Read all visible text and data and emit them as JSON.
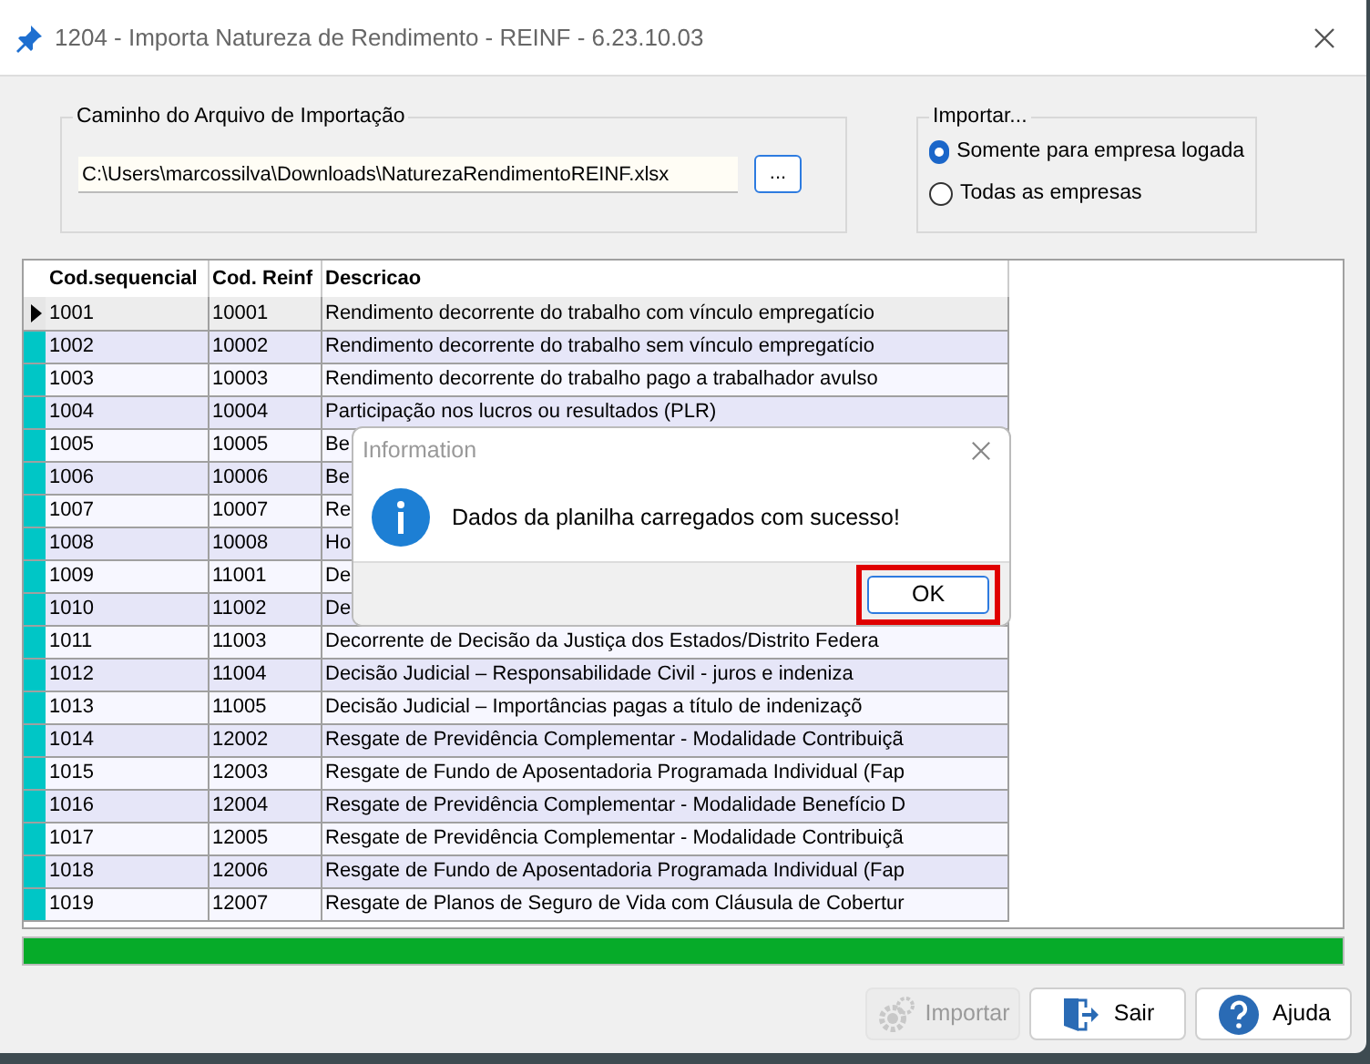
{
  "window": {
    "title": "1204 - Importa Natureza de Rendimento - REINF - 6.23.10.03"
  },
  "file_group": {
    "label": "Caminho do Arquivo de Importação",
    "path": "C:\\Users\\marcossilva\\Downloads\\NaturezaRendimentoREINF.xlsx",
    "browse_button": "..."
  },
  "import_group": {
    "label": "Importar...",
    "options": [
      {
        "label": "Somente para empresa logada",
        "selected": true
      },
      {
        "label": "Todas as empresas",
        "selected": false
      }
    ]
  },
  "table": {
    "columns": [
      "Cod.sequencial",
      "Cod. Reinf",
      "Descricao"
    ],
    "rows": [
      {
        "cells": [
          "1001",
          "10001",
          "Rendimento decorrente do trabalho com vínculo empregatício"
        ],
        "selected": true
      },
      {
        "cells": [
          "1002",
          "10002",
          "Rendimento decorrente do trabalho sem vínculo empregatício"
        ],
        "selected": false
      },
      {
        "cells": [
          "1003",
          "10003",
          "Rendimento decorrente do trabalho pago a trabalhador avulso"
        ],
        "selected": false
      },
      {
        "cells": [
          "1004",
          "10004",
          "Participação nos lucros ou resultados (PLR)"
        ],
        "selected": false
      },
      {
        "cells": [
          "1005",
          "10005",
          "Be"
        ],
        "selected": false
      },
      {
        "cells": [
          "1006",
          "10006",
          "Be"
        ],
        "selected": false
      },
      {
        "cells": [
          "1007",
          "10007",
          "Re"
        ],
        "selected": false
      },
      {
        "cells": [
          "1008",
          "10008",
          "Ho"
        ],
        "selected": false
      },
      {
        "cells": [
          "1009",
          "11001",
          "De"
        ],
        "selected": false
      },
      {
        "cells": [
          "1010",
          "11002",
          "De"
        ],
        "selected": false
      },
      {
        "cells": [
          "1011",
          "11003",
          "Decorrente de Decisão da Justiça dos Estados/Distrito Federa"
        ],
        "selected": false
      },
      {
        "cells": [
          "1012",
          "11004",
          "Decisão Judicial – Responsabilidade Civil - juros e indeniza"
        ],
        "selected": false
      },
      {
        "cells": [
          "1013",
          "11005",
          "Decisão Judicial – Importâncias pagas a título de indenizaçõ"
        ],
        "selected": false
      },
      {
        "cells": [
          "1014",
          "12002",
          "Resgate de Previdência Complementar - Modalidade Contribuiçã"
        ],
        "selected": false
      },
      {
        "cells": [
          "1015",
          "12003",
          "Resgate de Fundo de Aposentadoria Programada Individual (Fap"
        ],
        "selected": false
      },
      {
        "cells": [
          "1016",
          "12004",
          "Resgate de Previdência Complementar - Modalidade Benefício D"
        ],
        "selected": false
      },
      {
        "cells": [
          "1017",
          "12005",
          "Resgate de Previdência Complementar - Modalidade Contribuiçã"
        ],
        "selected": false
      },
      {
        "cells": [
          "1018",
          "12006",
          "Resgate de Fundo de Aposentadoria Programada Individual (Fap"
        ],
        "selected": false
      },
      {
        "cells": [
          "1019",
          "12007",
          "Resgate de Planos de Seguro de Vida com Cláusula de Cobertur"
        ],
        "selected": false
      }
    ]
  },
  "progress": {
    "level": 1
  },
  "buttons": [
    {
      "label": "Importar",
      "kind": "gear",
      "disabled": true
    },
    {
      "label": "Sair",
      "kind": "exit",
      "disabled": false
    },
    {
      "label": "Ajuda",
      "kind": "help",
      "disabled": false
    }
  ],
  "dialog": {
    "title": "Information",
    "message": "Dados da planilha carregados com sucesso!",
    "button": {
      "label": "OK",
      "highlighted": true
    }
  }
}
